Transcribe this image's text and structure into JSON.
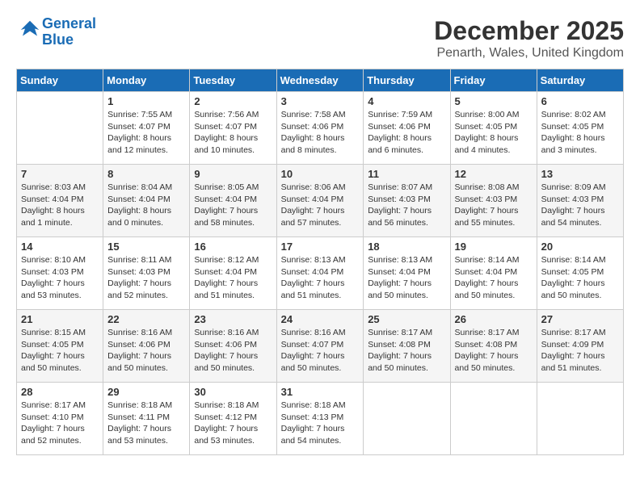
{
  "header": {
    "logo_line1": "General",
    "logo_line2": "Blue",
    "month": "December 2025",
    "location": "Penarth, Wales, United Kingdom"
  },
  "weekdays": [
    "Sunday",
    "Monday",
    "Tuesday",
    "Wednesday",
    "Thursday",
    "Friday",
    "Saturday"
  ],
  "weeks": [
    [
      {
        "day": "",
        "info": ""
      },
      {
        "day": "1",
        "info": "Sunrise: 7:55 AM\nSunset: 4:07 PM\nDaylight: 8 hours\nand 12 minutes."
      },
      {
        "day": "2",
        "info": "Sunrise: 7:56 AM\nSunset: 4:07 PM\nDaylight: 8 hours\nand 10 minutes."
      },
      {
        "day": "3",
        "info": "Sunrise: 7:58 AM\nSunset: 4:06 PM\nDaylight: 8 hours\nand 8 minutes."
      },
      {
        "day": "4",
        "info": "Sunrise: 7:59 AM\nSunset: 4:06 PM\nDaylight: 8 hours\nand 6 minutes."
      },
      {
        "day": "5",
        "info": "Sunrise: 8:00 AM\nSunset: 4:05 PM\nDaylight: 8 hours\nand 4 minutes."
      },
      {
        "day": "6",
        "info": "Sunrise: 8:02 AM\nSunset: 4:05 PM\nDaylight: 8 hours\nand 3 minutes."
      }
    ],
    [
      {
        "day": "7",
        "info": "Sunrise: 8:03 AM\nSunset: 4:04 PM\nDaylight: 8 hours\nand 1 minute."
      },
      {
        "day": "8",
        "info": "Sunrise: 8:04 AM\nSunset: 4:04 PM\nDaylight: 8 hours\nand 0 minutes."
      },
      {
        "day": "9",
        "info": "Sunrise: 8:05 AM\nSunset: 4:04 PM\nDaylight: 7 hours\nand 58 minutes."
      },
      {
        "day": "10",
        "info": "Sunrise: 8:06 AM\nSunset: 4:04 PM\nDaylight: 7 hours\nand 57 minutes."
      },
      {
        "day": "11",
        "info": "Sunrise: 8:07 AM\nSunset: 4:03 PM\nDaylight: 7 hours\nand 56 minutes."
      },
      {
        "day": "12",
        "info": "Sunrise: 8:08 AM\nSunset: 4:03 PM\nDaylight: 7 hours\nand 55 minutes."
      },
      {
        "day": "13",
        "info": "Sunrise: 8:09 AM\nSunset: 4:03 PM\nDaylight: 7 hours\nand 54 minutes."
      }
    ],
    [
      {
        "day": "14",
        "info": "Sunrise: 8:10 AM\nSunset: 4:03 PM\nDaylight: 7 hours\nand 53 minutes."
      },
      {
        "day": "15",
        "info": "Sunrise: 8:11 AM\nSunset: 4:03 PM\nDaylight: 7 hours\nand 52 minutes."
      },
      {
        "day": "16",
        "info": "Sunrise: 8:12 AM\nSunset: 4:04 PM\nDaylight: 7 hours\nand 51 minutes."
      },
      {
        "day": "17",
        "info": "Sunrise: 8:13 AM\nSunset: 4:04 PM\nDaylight: 7 hours\nand 51 minutes."
      },
      {
        "day": "18",
        "info": "Sunrise: 8:13 AM\nSunset: 4:04 PM\nDaylight: 7 hours\nand 50 minutes."
      },
      {
        "day": "19",
        "info": "Sunrise: 8:14 AM\nSunset: 4:04 PM\nDaylight: 7 hours\nand 50 minutes."
      },
      {
        "day": "20",
        "info": "Sunrise: 8:14 AM\nSunset: 4:05 PM\nDaylight: 7 hours\nand 50 minutes."
      }
    ],
    [
      {
        "day": "21",
        "info": "Sunrise: 8:15 AM\nSunset: 4:05 PM\nDaylight: 7 hours\nand 50 minutes."
      },
      {
        "day": "22",
        "info": "Sunrise: 8:16 AM\nSunset: 4:06 PM\nDaylight: 7 hours\nand 50 minutes."
      },
      {
        "day": "23",
        "info": "Sunrise: 8:16 AM\nSunset: 4:06 PM\nDaylight: 7 hours\nand 50 minutes."
      },
      {
        "day": "24",
        "info": "Sunrise: 8:16 AM\nSunset: 4:07 PM\nDaylight: 7 hours\nand 50 minutes."
      },
      {
        "day": "25",
        "info": "Sunrise: 8:17 AM\nSunset: 4:08 PM\nDaylight: 7 hours\nand 50 minutes."
      },
      {
        "day": "26",
        "info": "Sunrise: 8:17 AM\nSunset: 4:08 PM\nDaylight: 7 hours\nand 50 minutes."
      },
      {
        "day": "27",
        "info": "Sunrise: 8:17 AM\nSunset: 4:09 PM\nDaylight: 7 hours\nand 51 minutes."
      }
    ],
    [
      {
        "day": "28",
        "info": "Sunrise: 8:17 AM\nSunset: 4:10 PM\nDaylight: 7 hours\nand 52 minutes."
      },
      {
        "day": "29",
        "info": "Sunrise: 8:18 AM\nSunset: 4:11 PM\nDaylight: 7 hours\nand 53 minutes."
      },
      {
        "day": "30",
        "info": "Sunrise: 8:18 AM\nSunset: 4:12 PM\nDaylight: 7 hours\nand 53 minutes."
      },
      {
        "day": "31",
        "info": "Sunrise: 8:18 AM\nSunset: 4:13 PM\nDaylight: 7 hours\nand 54 minutes."
      },
      {
        "day": "",
        "info": ""
      },
      {
        "day": "",
        "info": ""
      },
      {
        "day": "",
        "info": ""
      }
    ]
  ]
}
